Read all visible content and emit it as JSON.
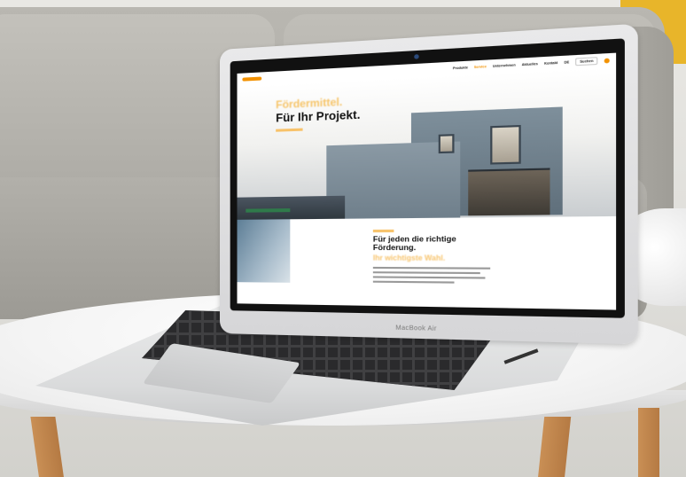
{
  "laptop": {
    "brand_label": "MacBook Air"
  },
  "website": {
    "nav": {
      "items": [
        "Produkte",
        "Service",
        "Unternehmen",
        "Aktuelles",
        "Kontakt"
      ],
      "active_index": 1,
      "lang": "DE",
      "button": "Suchen"
    },
    "hero": {
      "kicker": "Fördermittel.",
      "title": "Für Ihr Projekt."
    },
    "section": {
      "title_line1": "Für jeden die richtige",
      "title_line2": "Förderung.",
      "accent": "Ihr wichtigste Wahl."
    }
  },
  "colors": {
    "accent": "#f29100",
    "accent_light": "#f7c46e"
  }
}
